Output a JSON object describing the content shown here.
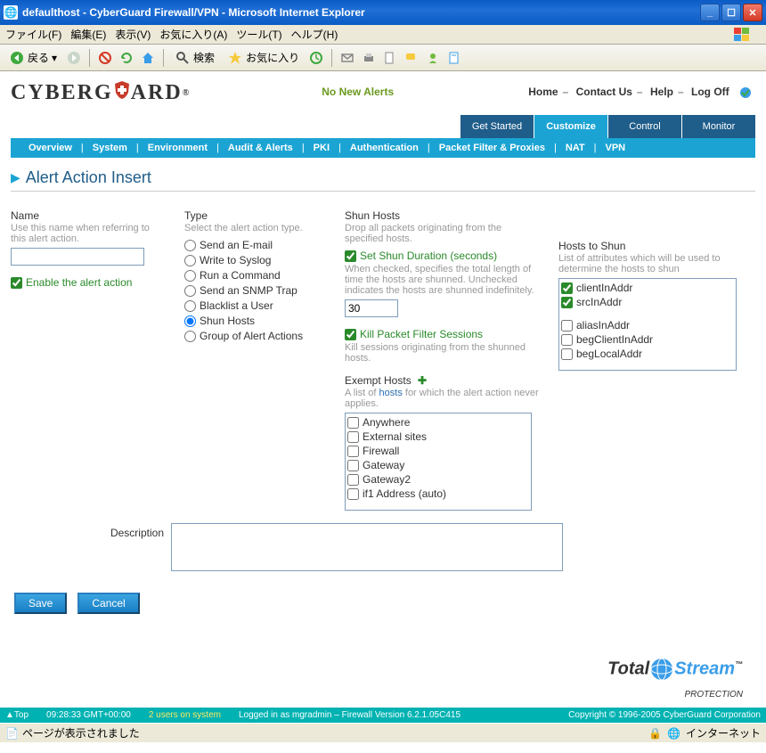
{
  "window": {
    "title": "defaulthost - CyberGuard Firewall/VPN - Microsoft Internet Explorer"
  },
  "menubar": [
    "ファイル(F)",
    "編集(E)",
    "表示(V)",
    "お気に入り(A)",
    "ツール(T)",
    "ヘルプ(H)"
  ],
  "toolbar": {
    "back": "戻る",
    "search": "検索",
    "favorites": "お気に入り"
  },
  "header": {
    "brand_a": "CYBERG",
    "brand_b": "ARD",
    "alerts": "No New Alerts",
    "links": {
      "home": "Home",
      "contact": "Contact Us",
      "help": "Help",
      "logoff": "Log Off"
    }
  },
  "mode_tabs": {
    "get_started": "Get Started",
    "customize": "Customize",
    "control": "Control",
    "monitor": "Monitor"
  },
  "nav": [
    "Overview",
    "System",
    "Environment",
    "Audit & Alerts",
    "PKI",
    "Authentication",
    "Packet Filter & Proxies",
    "NAT",
    "VPN"
  ],
  "page_title": "Alert Action Insert",
  "name_section": {
    "label": "Name",
    "help": "Use this name when referring to this alert action.",
    "value": "",
    "enable_label": "Enable the alert action"
  },
  "type_section": {
    "label": "Type",
    "help": "Select the alert action type.",
    "options": [
      "Send an E-mail",
      "Write to Syslog",
      "Run a Command",
      "Send an SNMP Trap",
      "Blacklist a User",
      "Shun Hosts",
      "Group of Alert Actions"
    ],
    "selected_index": 5
  },
  "shun_section": {
    "label": "Shun Hosts",
    "help": "Drop all packets originating from the specified hosts.",
    "set_duration_label": "Set Shun Duration (seconds)",
    "duration_help": "When checked, specifies the total length of time the hosts are shunned. Unchecked indicates the hosts are shunned indefinitely.",
    "duration_value": "30",
    "kill_label": "Kill Packet Filter Sessions",
    "kill_help": "Kill sessions originating from the shunned hosts.",
    "exempt_label": "Exempt Hosts",
    "exempt_help_a": "A list of ",
    "exempt_help_link": "hosts",
    "exempt_help_b": " for which the alert action never applies.",
    "exempt_items": [
      "Anywhere",
      "External sites",
      "Firewall",
      "Gateway",
      "Gateway2",
      "if1 Address (auto)"
    ]
  },
  "hosts_to_shun": {
    "label": "Hosts to Shun",
    "help": "List of attributes which will be used to determine the hosts to shun",
    "items": [
      {
        "label": "clientInAddr",
        "checked": true
      },
      {
        "label": "srcInAddr",
        "checked": true
      },
      {
        "label": "aliasInAddr",
        "checked": false
      },
      {
        "label": "begClientInAddr",
        "checked": false
      },
      {
        "label": "begLocalAddr",
        "checked": false
      }
    ]
  },
  "description_label": "Description",
  "buttons": {
    "save": "Save",
    "cancel": "Cancel"
  },
  "bottom_logo": {
    "a": "Total",
    "b": "Stream",
    "c": "PROTECTION"
  },
  "footer": {
    "top": "▲Top",
    "time": "09:28:33 GMT+00:00",
    "users": "2 users on system",
    "login": "Logged in as mgradmin – Firewall Version 6.2.1.05C415",
    "copyright": "Copyright © 1996-2005 CyberGuard Corporation"
  },
  "status": {
    "left": "ページが表示されました",
    "right": "インターネット"
  }
}
